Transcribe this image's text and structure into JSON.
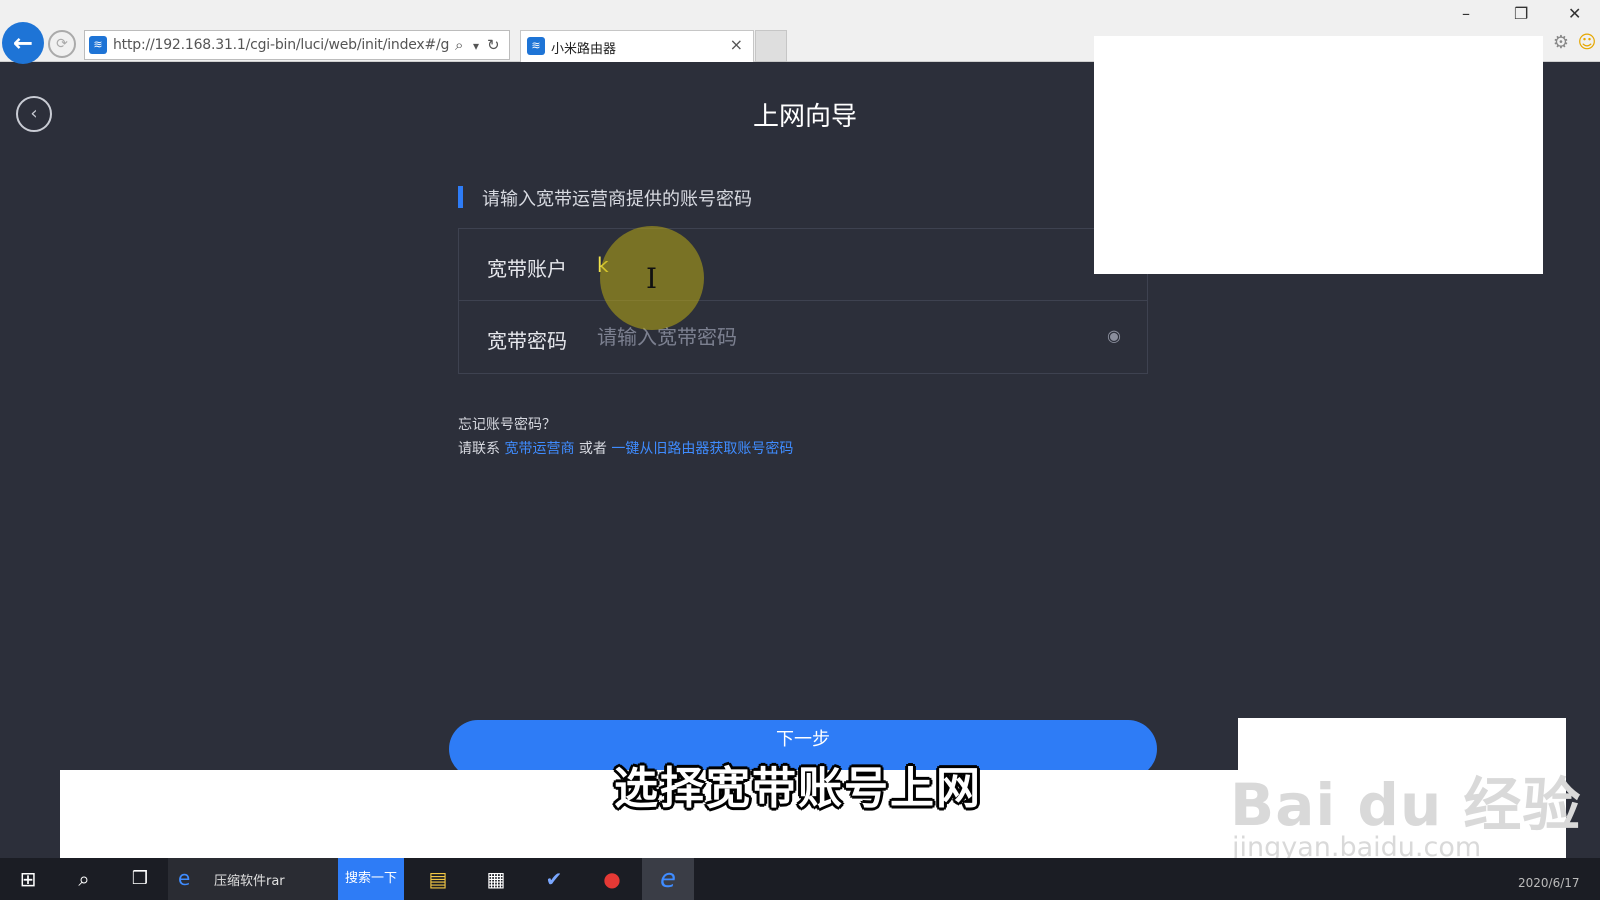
{
  "browser": {
    "url": "http://192.168.31.1/cgi-bin/luci/web/init/index#/g",
    "tab_title": "小米路由器",
    "tab_close": "×",
    "back_glyph": "←",
    "forward_glyph": "⟳",
    "search_glyph": "⌕",
    "dropdown_glyph": "▾",
    "refresh_glyph": "↻",
    "window_minimize": "–",
    "window_restore": "❐",
    "window_close": "✕",
    "settings_glyph": "⚙",
    "smiley_glyph": "☺",
    "favicon_glyph": "≋"
  },
  "page": {
    "back_glyph": "‹",
    "title": "上网向导",
    "section_label": "请输入宽带运营商提供的账号密码",
    "account_label": "宽带账户",
    "account_value": "k",
    "password_label": "宽带密码",
    "password_placeholder": "请输入宽带密码",
    "eye_glyph": "◉",
    "forgot_text": "忘记账号密码？",
    "contact_prefix": "请联系",
    "contact_link1": "宽带运营商",
    "contact_or": "或者",
    "contact_link2": "一键从旧路由器获取账号密码",
    "next_button": "下一步",
    "ibeam_glyph": "I"
  },
  "overlay": {
    "subtitle": "选择宽带账号上网",
    "watermark_logo": "Bai du 经验",
    "watermark_url": "jingyan.baidu.com"
  },
  "taskbar": {
    "start_glyph": "⊞",
    "search_glyph": "⌕",
    "taskview_glyph": "❒",
    "search_text": "压缩软件rar",
    "search_ie_glyph": "e",
    "search_button": "搜索一下",
    "explorer_glyph": "▤",
    "store_glyph": "▦",
    "app_glyph": "✔",
    "record_glyph": "●",
    "ie_glyph": "e",
    "clock": "2020/6/17"
  },
  "colors": {
    "page_bg": "#2c2f3a",
    "accent": "#2e7cf6",
    "link": "#3f8cff"
  }
}
